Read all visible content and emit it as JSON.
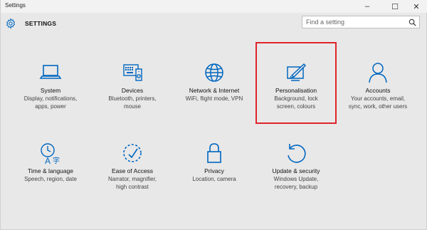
{
  "window": {
    "title": "Settings",
    "controls": {
      "minimize": "–",
      "maximize": "☐",
      "close": "✕"
    }
  },
  "header": {
    "title": "SETTINGS",
    "icon": "gear-icon",
    "search": {
      "placeholder": "Find a setting",
      "value": "",
      "icon": "search-icon"
    }
  },
  "accent_color": "#0067c0",
  "highlight_color": "#e0242a",
  "tiles": [
    {
      "name": "System",
      "desc1": "Display, notifications,",
      "desc2": "apps, power",
      "icon": "laptop-icon"
    },
    {
      "name": "Devices",
      "desc1": "Bluetooth, printers,",
      "desc2": "mouse",
      "icon": "devices-icon"
    },
    {
      "name": "Network & Internet",
      "desc1": "WiFi, flight mode, VPN",
      "desc2": "",
      "icon": "globe-icon"
    },
    {
      "name": "Personalisation",
      "desc1": "Background, lock",
      "desc2": "screen, colours",
      "icon": "personalisation-icon",
      "highlighted": true
    },
    {
      "name": "Accounts",
      "desc1": "Your accounts, email,",
      "desc2": "sync, work, other users",
      "icon": "person-icon"
    },
    {
      "name": "Time & language",
      "desc1": "Speech, region, date",
      "desc2": "",
      "icon": "time-language-icon"
    },
    {
      "name": "Ease of Access",
      "desc1": "Narrator, magnifier,",
      "desc2": "high contrast",
      "icon": "ease-of-access-icon"
    },
    {
      "name": "Privacy",
      "desc1": "Location, camera",
      "desc2": "",
      "icon": "lock-icon"
    },
    {
      "name": "Update & security",
      "desc1": "Windows Update,",
      "desc2": "recovery, backup",
      "icon": "update-icon"
    }
  ]
}
